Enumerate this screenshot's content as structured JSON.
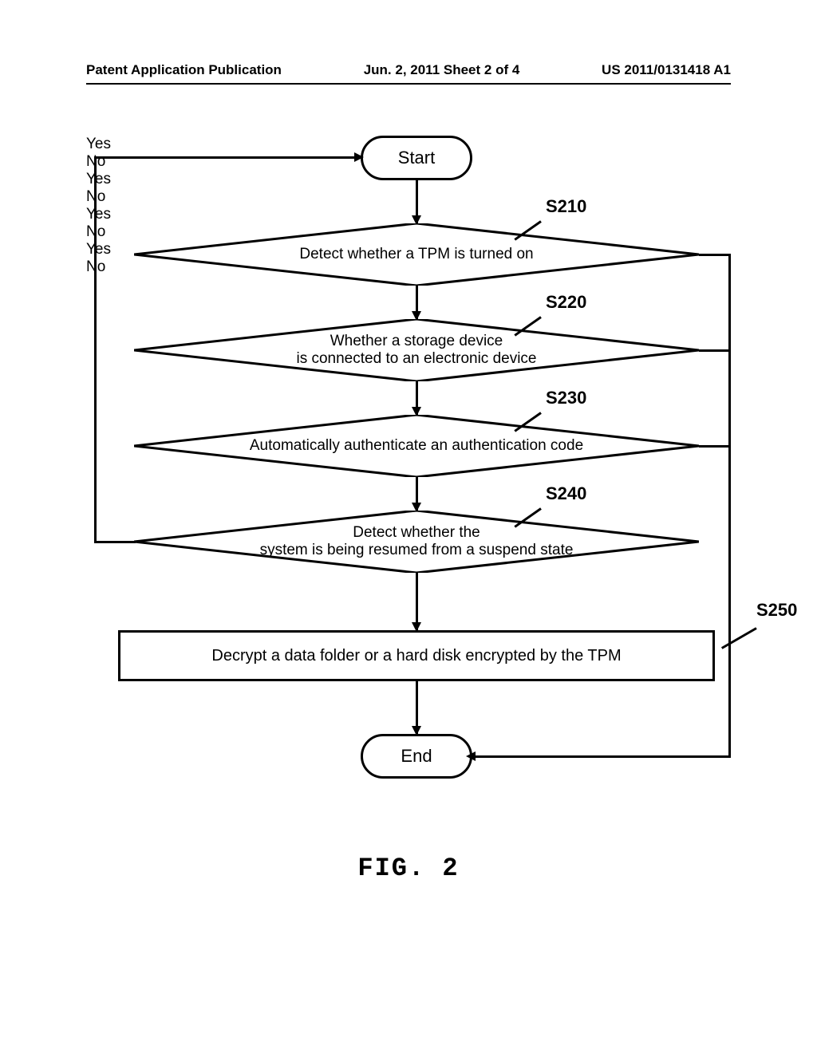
{
  "header": {
    "left": "Patent Application Publication",
    "center": "Jun. 2, 2011  Sheet 2 of 4",
    "right": "US 2011/0131418 A1"
  },
  "flowchart": {
    "start": "Start",
    "end": "End",
    "s210": {
      "id": "S210",
      "text": "Detect whether a TPM is turned on",
      "yes": "Yes",
      "no": "No"
    },
    "s220": {
      "id": "S220",
      "text1": "Whether a storage device",
      "text2": "is connected to an electronic device",
      "yes": "Yes",
      "no": "No"
    },
    "s230": {
      "id": "S230",
      "text": "Automatically authenticate an authentication code",
      "yes": "Yes",
      "no": "No"
    },
    "s240": {
      "id": "S240",
      "text1": "Detect whether the",
      "text2": "system is being resumed from a suspend state",
      "yes": "Yes",
      "no": "No"
    },
    "s250": {
      "id": "S250",
      "text": "Decrypt a data folder or a hard disk encrypted by the TPM"
    }
  },
  "caption": "FIG. 2"
}
